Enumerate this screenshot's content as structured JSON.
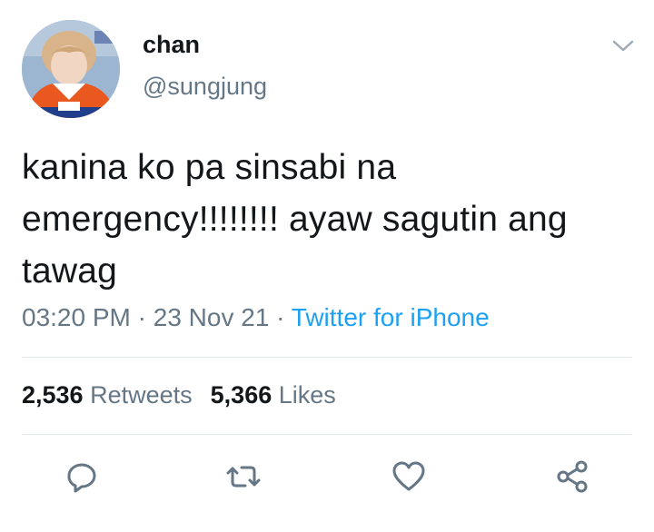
{
  "tweet": {
    "display_name": "chan",
    "handle": "@sungjung",
    "text": "kanina ko pa sinsabi na emergency!!!!!!!! ayaw sagutin ang tawag",
    "time": "03:20 PM",
    "separator": " · ",
    "date": "23 Nov 21",
    "source": "Twitter for iPhone"
  },
  "stats": {
    "retweets_count": "2,536",
    "retweets_label": "Retweets",
    "likes_count": "5,366",
    "likes_label": "Likes"
  },
  "icons": {
    "more": "chevron-down-icon",
    "reply": "reply-icon",
    "retweet": "retweet-icon",
    "like": "heart-icon",
    "share": "share-icon"
  },
  "colors": {
    "text": "#14171a",
    "secondary": "#657786",
    "link": "#1da1f2",
    "divider": "#e1e8ed"
  }
}
